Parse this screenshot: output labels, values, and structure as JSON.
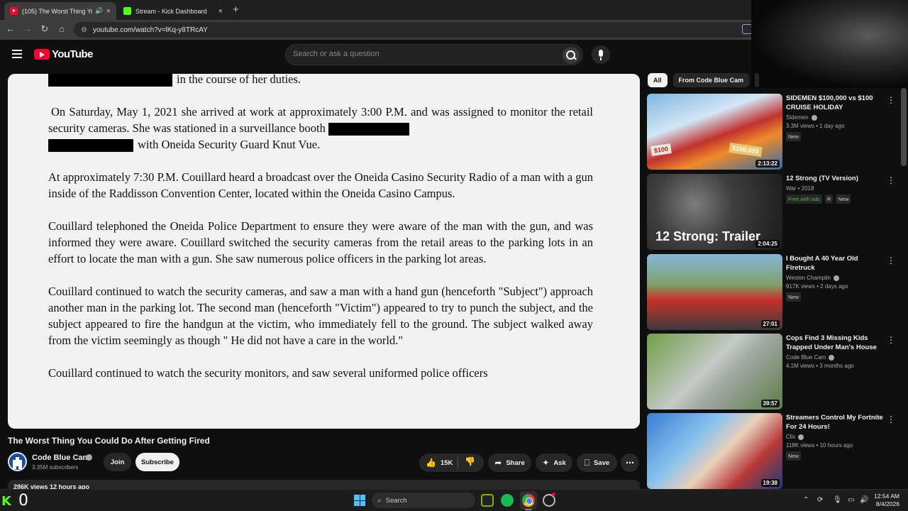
{
  "browser": {
    "tabs": [
      {
        "label": "(105) The Worst Thing You",
        "audio_icon": "speaker-icon",
        "close": "×"
      },
      {
        "label": "Stream - Kick Dashboard",
        "close": "×"
      }
    ],
    "new_tab": "+",
    "url": "youtube.com/watch?v=lKq-y8TRcAY"
  },
  "youtube": {
    "logo_text": "YouTube",
    "search_placeholder": "Search or ask a question"
  },
  "video": {
    "document_paragraphs": [
      "in the course of her duties.",
      "On Saturday, May 1, 2021 she arrived at work at approximately 3:00 P.M. and was assigned to monitor the retail security cameras. She was stationed in a surveillance booth",
      "with Oneida Security Guard Knut Vue.",
      "At approximately 7:30 P.M. Couillard heard a broadcast over the Oneida Casino Security Radio of a man with a gun inside of the Raddisson Convention Center, located within the Oneida Casino Campus.",
      "Couillard telephoned the Oneida Police Department to ensure they were aware of the man with the gun, and was informed they were aware. Couillard switched the security cameras from the retail areas to the parking lots in an effort to locate the man with a gun. She saw numerous police officers in the parking lot areas.",
      "Couillard continued to watch the security cameras, and saw a man with a hand gun (henceforth \"Subject\") approach another man in the parking lot. The second man (henceforth \"Victim\") appeared to try to punch the subject, and the subject appeared to fire the handgun at the victim, who immediately fell to the ground. The subject walked away from the victim seemingly as though \" He did not have a care in the world.\"",
      "Couillard continued to watch the security monitors, and saw several uniformed police officers"
    ],
    "title": "The Worst Thing You Could Do After Getting Fired",
    "channel": "Code Blue Cam",
    "subscribers": "3.35M subscribers",
    "join_label": "Join",
    "subscribe_label": "Subscribe",
    "likes": "15K",
    "share_label": "Share",
    "ask_label": "Ask",
    "save_label": "Save",
    "description_meta": "286K views  12 hours ago"
  },
  "sidebar": {
    "chips": [
      "All",
      "From Code Blue Cam"
    ],
    "items": [
      {
        "title": "SIDEMEN $100,000 vs $100 CRUISE HOLIDAY",
        "channel": "Sidemen",
        "verified": true,
        "meta": "3.3M views • 1 day ago",
        "badges": [
          "New"
        ],
        "duration": "2:13:22",
        "thumb_left": "$100",
        "thumb_right": "$100,000"
      },
      {
        "title": "12 Strong (TV Version)",
        "channel": "War • 2018",
        "verified": false,
        "meta": "",
        "badges": [
          "Free with ads",
          "R",
          "New"
        ],
        "duration": "2:04:25",
        "thumb_caption": "12 Strong: Trailer"
      },
      {
        "title": "I Bought A 40 Year Old Firetruck",
        "channel": "Westen Champlin",
        "verified": true,
        "meta": "917K views • 2 days ago",
        "badges": [
          "New"
        ],
        "duration": "27:01"
      },
      {
        "title": "Cops Find 3 Missing Kids Trapped Under Man's House",
        "channel": "Code Blue Cam",
        "verified": true,
        "meta": "4.1M views • 3 months ago",
        "badges": [],
        "duration": "39:57"
      },
      {
        "title": "Streamers Control My Fortnite For 24 Hours!",
        "channel": "Clix",
        "verified": true,
        "meta": "118K views • 10 hours ago",
        "badges": [
          "New"
        ],
        "duration": "19:38"
      }
    ]
  },
  "taskbar": {
    "kick_counter": "0",
    "search_label": "Search",
    "time": "12:54 AM",
    "date": "8/4/2026"
  }
}
